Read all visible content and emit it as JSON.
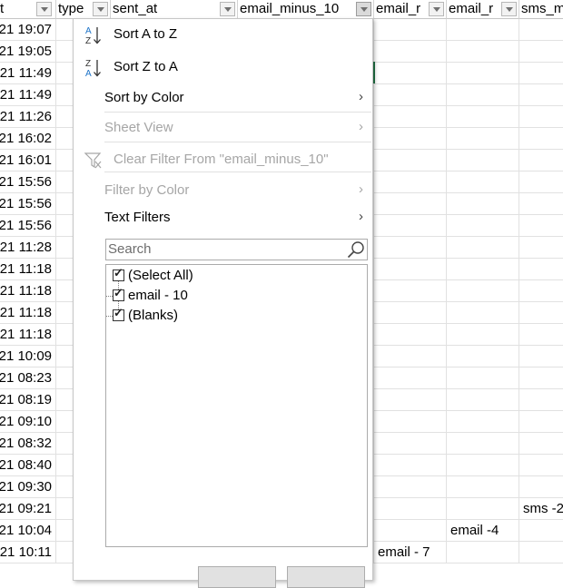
{
  "headers": [
    {
      "label": "t"
    },
    {
      "label": "type"
    },
    {
      "label": "sent_at"
    },
    {
      "label": "email_minus_10"
    },
    {
      "label": "email_r"
    },
    {
      "label": "email_r"
    },
    {
      "label": "sms_m"
    }
  ],
  "rows": [
    {
      "time": "21 19:07",
      "c4": "",
      "c5": "",
      "c6": ""
    },
    {
      "time": "21 19:05",
      "c4": "",
      "c5": "",
      "c6": ""
    },
    {
      "time": "21 11:49",
      "c4": "",
      "c5": "",
      "c6": ""
    },
    {
      "time": "21 11:49",
      "c4": "",
      "c5": "",
      "c6": ""
    },
    {
      "time": "21 11:26",
      "c4": "",
      "c5": "",
      "c6": ""
    },
    {
      "time": "21 16:02",
      "c4": "",
      "c5": "",
      "c6": ""
    },
    {
      "time": "21 16:01",
      "c4": "",
      "c5": "",
      "c6": ""
    },
    {
      "time": "21 15:56",
      "c4": "",
      "c5": "",
      "c6": ""
    },
    {
      "time": "21 15:56",
      "c4": "",
      "c5": "",
      "c6": ""
    },
    {
      "time": "21 15:56",
      "c4": "",
      "c5": "",
      "c6": ""
    },
    {
      "time": "21 11:28",
      "c4": "",
      "c5": "",
      "c6": ""
    },
    {
      "time": "21 11:18",
      "c4": "",
      "c5": "",
      "c6": ""
    },
    {
      "time": "21 11:18",
      "c4": "",
      "c5": "",
      "c6": ""
    },
    {
      "time": "21 11:18",
      "c4": "",
      "c5": "",
      "c6": ""
    },
    {
      "time": "21 11:18",
      "c4": "",
      "c5": "",
      "c6": ""
    },
    {
      "time": "21 10:09",
      "c4": "",
      "c5": "",
      "c6": ""
    },
    {
      "time": "21 08:23",
      "c4": "",
      "c5": "",
      "c6": ""
    },
    {
      "time": "21 08:19",
      "c4": "",
      "c5": "",
      "c6": ""
    },
    {
      "time": "21 09:10",
      "c4": "",
      "c5": "",
      "c6": ""
    },
    {
      "time": "21 08:32",
      "c4": "",
      "c5": "",
      "c6": ""
    },
    {
      "time": "21 08:40",
      "c4": "",
      "c5": "",
      "c6": ""
    },
    {
      "time": "21 09:30",
      "c4": "",
      "c5": "",
      "c6": ""
    },
    {
      "time": "21 09:21",
      "c4": "",
      "c5": "",
      "c6": "sms -2"
    },
    {
      "time": "21 10:04",
      "c4": "",
      "c5": "email -4",
      "c6": ""
    },
    {
      "time": "21 10:11",
      "c4": "email - 7",
      "c5": "",
      "c6": ""
    }
  ],
  "menu": {
    "sort_az": "Sort A to Z",
    "sort_za": "Sort Z to A",
    "sort_by_color": "Sort by Color",
    "sheet_view": "Sheet View",
    "clear_filter": "Clear Filter From \"email_minus_10\"",
    "filter_by_color": "Filter by Color",
    "text_filters": "Text Filters",
    "search_placeholder": "Search",
    "list": [
      "(Select All)",
      "email - 10",
      "(Blanks)"
    ]
  }
}
